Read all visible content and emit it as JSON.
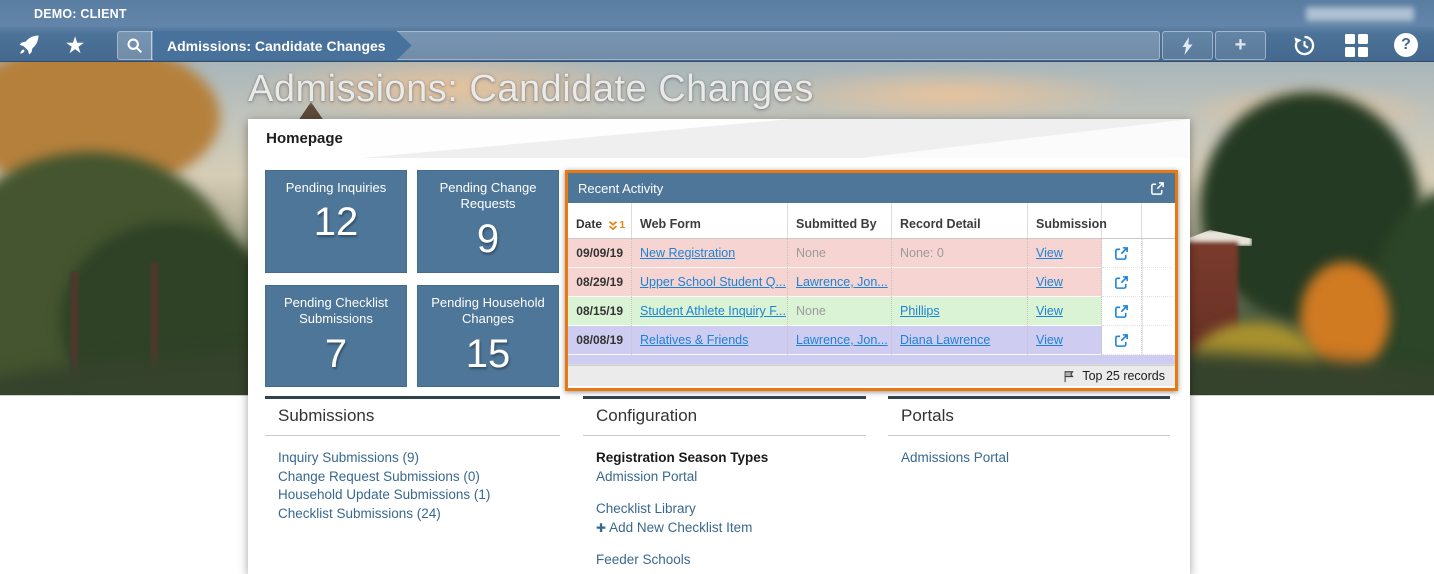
{
  "topbar": {
    "environment_label": "DEMO: CLIENT",
    "breadcrumb": "Admissions: Candidate Changes",
    "icons": {
      "star": "★",
      "plus": "+",
      "help": "?"
    }
  },
  "page": {
    "title": "Admissions: Candidate Changes",
    "tab": "Homepage"
  },
  "tiles": [
    {
      "label": "Pending Inquiries",
      "value": "12"
    },
    {
      "label": "Pending Change Requests",
      "value": "9"
    },
    {
      "label": "Pending Checklist Submissions",
      "value": "7"
    },
    {
      "label": "Pending Household Changes",
      "value": "15"
    }
  ],
  "recent_activity": {
    "title": "Recent Activity",
    "columns": {
      "date": "Date",
      "web_form": "Web Form",
      "submitted_by": "Submitted By",
      "record_detail": "Record Detail",
      "submission": "Submission"
    },
    "sort": {
      "column": "Date",
      "direction": "desc",
      "order": "1"
    },
    "rows": [
      {
        "date": "09/09/19",
        "web_form": "New Registration",
        "submitted_by": "None",
        "record_detail": "None: 0",
        "submission": "View",
        "row_color": "pink"
      },
      {
        "date": "08/29/19",
        "web_form": "Upper School Student Q...",
        "submitted_by": "Lawrence, Jon...",
        "record_detail": "",
        "submission": "View",
        "row_color": "pink"
      },
      {
        "date": "08/15/19",
        "web_form": "Student Athlete Inquiry F...",
        "submitted_by": "None",
        "record_detail": "Phillips",
        "submission": "View",
        "row_color": "green"
      },
      {
        "date": "08/08/19",
        "web_form": "Relatives & Friends",
        "submitted_by": "Lawrence, Jon...",
        "record_detail": "Diana Lawrence",
        "submission": "View",
        "row_color": "purple"
      }
    ],
    "footer": "Top 25 records"
  },
  "submissions": {
    "title": "Submissions",
    "links": [
      "Inquiry Submissions  (9)",
      "Change Request Submissions  (0)",
      "Household Update Submissions  (1)",
      "Checklist Submissions  (24)"
    ]
  },
  "configuration": {
    "title": "Configuration",
    "heading": "Registration Season Types",
    "link_admission_portal": "Admission Portal",
    "link_checklist_library": "Checklist Library",
    "link_add_checklist_item": "Add New Checklist Item",
    "add_icon": "✚",
    "link_feeder_schools": "Feeder Schools"
  },
  "portals": {
    "title": "Portals",
    "links": [
      "Admissions Portal"
    ]
  },
  "colors": {
    "accent_orange": "#E87812",
    "steel_blue": "#4D7699",
    "table_link": "#1D83D4",
    "section_link": "#39688F",
    "row_pink": "#F6D4D2",
    "row_green": "#DAF3D4",
    "row_purple": "#CFCCF1"
  }
}
